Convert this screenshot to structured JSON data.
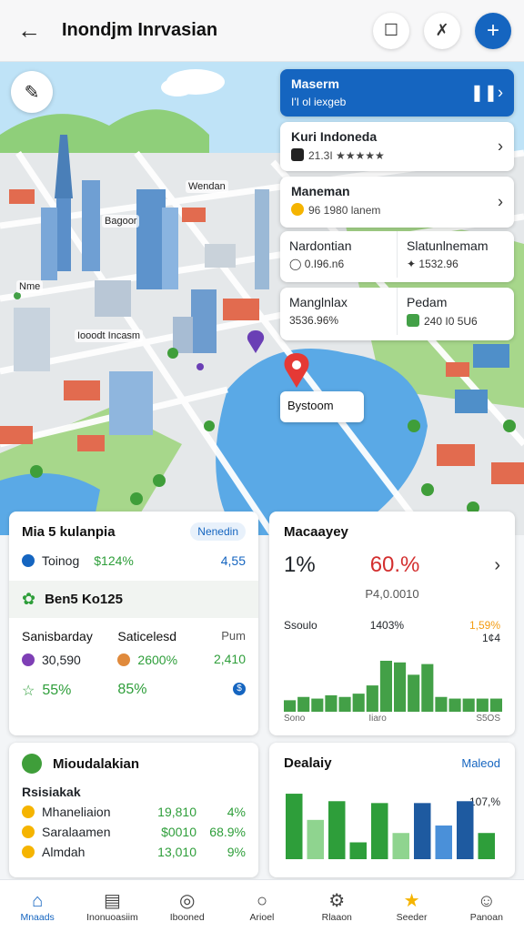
{
  "header": {
    "title": "Inondjm Inrvasian"
  },
  "map": {
    "labels": [
      "Wendan",
      "Bagoor",
      "Nme",
      "Iooodt Incasm"
    ],
    "pin_popup": "Bystoom",
    "overlays": {
      "top": {
        "title": "Maserm",
        "subtitle": "I'I ol iexgeb"
      },
      "item1": {
        "title": "Kuri Indoneda",
        "subtitle": "21.3I ★★★★★"
      },
      "item2": {
        "title": "Maneman",
        "subtitle": "96 1980 lanem"
      },
      "split1": {
        "left_title": "Nardontian",
        "left_value": "0.I96.n6",
        "right_title": "Slatunlnemam",
        "right_value": "1532.96"
      },
      "split2": {
        "left_title": "Manglnlax",
        "left_value": "3536.96%",
        "mid_title": "Pedam",
        "mid_value": "240 I0 5U6"
      }
    }
  },
  "card_left1": {
    "title": "Mia 5 kulanpia",
    "badge": "Nenedin",
    "row1_label": "Toinog",
    "row1_value": "$124%",
    "row1_right": "4,55",
    "sub_title": "Ben5 Ko125",
    "col_a_title": "Sanisbarday",
    "col_a_value": "30,590",
    "col_a_pct": "55%",
    "col_b_title": "Saticelesd",
    "col_b_value": "2600%",
    "col_b_pct": "85%",
    "col_c_title": "Pum",
    "col_c_value": "2,410",
    "col_c_icon": "$"
  },
  "card_right1": {
    "title": "Macaayey",
    "big_left": "1%",
    "big_right": "60.%",
    "sub": "P4,0.0010",
    "col1": "Ssoulo",
    "col2": "1403%",
    "col3": "1,59%",
    "col3b": "1¢4",
    "x1": "Sono",
    "x2": "Iiaro",
    "x3": "S5OS"
  },
  "card_left2": {
    "title": "Mioudalakian",
    "subtitle": "Rsisiakak",
    "rows": [
      {
        "label": "Mhaneliaion",
        "value": "19,810",
        "pct": "4%"
      },
      {
        "label": "Saralaamen",
        "value": "$0010",
        "pct": "68.9%"
      },
      {
        "label": "Almdah",
        "value": "13,010",
        "pct": "9%"
      }
    ]
  },
  "card_right2": {
    "title": "Dealaiy",
    "link": "Maleod",
    "pct": "107,%"
  },
  "chart_data": [
    {
      "type": "bar",
      "title": "Macaayey",
      "values": [
        14,
        18,
        16,
        20,
        18,
        22,
        32,
        62,
        60,
        45,
        58,
        18,
        16,
        16,
        16,
        16
      ],
      "colors": [
        "#43a047",
        "#43a047",
        "#43a047",
        "#43a047",
        "#43a047",
        "#43a047",
        "#43a047",
        "#43a047",
        "#43a047",
        "#43a047",
        "#43a047",
        "#43a047",
        "#43a047",
        "#43a047",
        "#43a047",
        "#43a047"
      ]
    },
    {
      "type": "bar",
      "title": "Dealaiy",
      "values": [
        70,
        42,
        62,
        18,
        60,
        28,
        60,
        36,
        62,
        28
      ],
      "colors": [
        "#2e9e3a",
        "#8fd48f",
        "#2e9e3a",
        "#2e9e3a",
        "#2e9e3a",
        "#8fd48f",
        "#1e5aa0",
        "#4a90d9",
        "#1e5aa0",
        "#2e9e3a"
      ]
    }
  ],
  "nav": [
    {
      "label": "Mnaads",
      "icon": "home-icon",
      "glyph": "⌂"
    },
    {
      "label": "Inonuoasiim",
      "icon": "building-icon",
      "glyph": "▤"
    },
    {
      "label": "Ibooned",
      "icon": "map-icon",
      "glyph": "◎"
    },
    {
      "label": "Arioel",
      "icon": "circle-icon",
      "glyph": "○"
    },
    {
      "label": "Rlaaon",
      "icon": "gear-icon",
      "glyph": "⚙"
    },
    {
      "label": "Seeder",
      "icon": "star-icon",
      "glyph": "★"
    },
    {
      "label": "Panoan",
      "icon": "user-icon",
      "glyph": "☺"
    }
  ]
}
